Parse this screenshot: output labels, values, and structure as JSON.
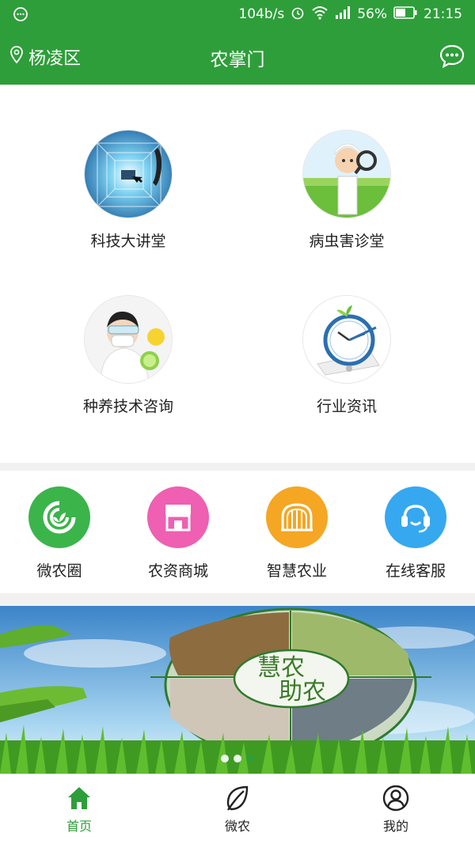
{
  "status_bar": {
    "speed": "104b/s",
    "battery": "56%",
    "time": "21:15"
  },
  "header": {
    "location": "杨凌区",
    "title": "农掌门"
  },
  "services": [
    {
      "label": "科技大讲堂",
      "icon": "tech-lecture-image"
    },
    {
      "label": "病虫害诊堂",
      "icon": "pest-diagnosis-image"
    },
    {
      "label": "种养技术咨询",
      "icon": "tech-consult-image"
    },
    {
      "label": "行业资讯",
      "icon": "industry-news-image"
    }
  ],
  "quick_links": [
    {
      "label": "微农圈",
      "color": "#3bb44a",
      "icon": "micro-agri-circle-icon"
    },
    {
      "label": "农资商城",
      "color": "#ef5fb2",
      "icon": "store-icon"
    },
    {
      "label": "智慧农业",
      "color": "#f5a623",
      "icon": "greenhouse-icon"
    },
    {
      "label": "在线客服",
      "color": "#36a8f0",
      "icon": "customer-service-icon"
    }
  ],
  "banner": {
    "text_line1": "慧农",
    "text_line2": "助农",
    "slide_count": 3,
    "active_slide": 3
  },
  "bottom_nav": [
    {
      "label": "首页",
      "icon": "home-icon",
      "active": true
    },
    {
      "label": "微农",
      "icon": "leaf-icon",
      "active": false
    },
    {
      "label": "我的",
      "icon": "user-icon",
      "active": false
    }
  ],
  "colors": {
    "brand": "#2e9e3a",
    "divider": "#f1f1f1"
  }
}
